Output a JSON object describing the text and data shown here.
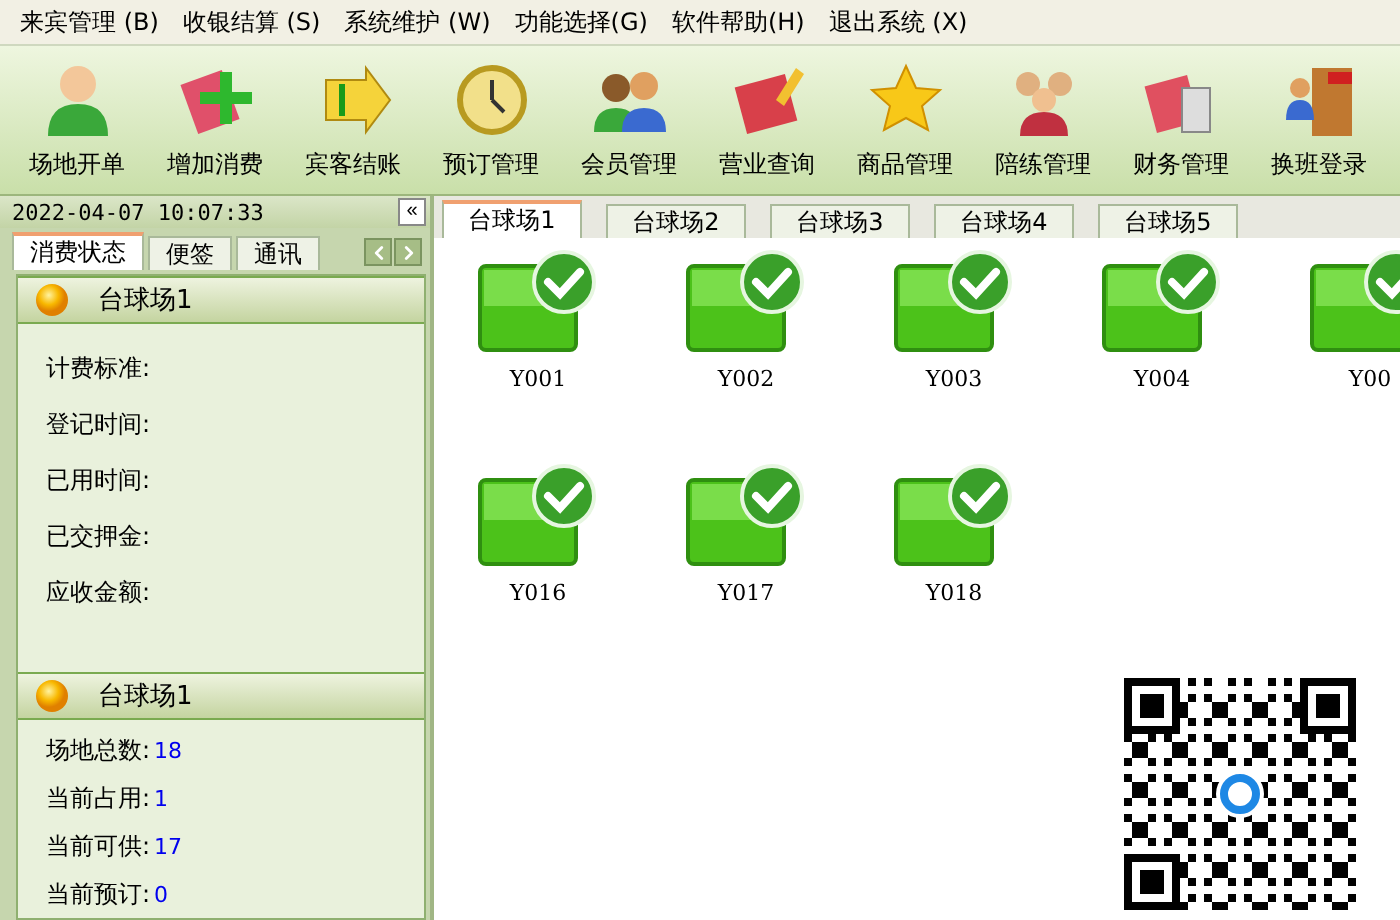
{
  "menu": [
    "来宾管理 (B)",
    "收银结算 (S)",
    "系统维护 (W)",
    "功能选择(G)",
    "软件帮助(H)",
    "退出系统 (X)"
  ],
  "toolbar": [
    "场地开单",
    "增加消费",
    "宾客结账",
    "预订管理",
    "会员管理",
    "营业查询",
    "商品管理",
    "陪练管理",
    "财务管理",
    "换班登录"
  ],
  "clock": "2022-04-07 10:07:33",
  "collapse": "«",
  "side_tabs": [
    {
      "label": "消费状态",
      "selected": true
    },
    {
      "label": "便签",
      "selected": false
    },
    {
      "label": "通讯",
      "selected": false
    }
  ],
  "sections": [
    {
      "title": "台球场1",
      "fields": [
        {
          "label": "计费标准:"
        },
        {
          "label": "登记时间:"
        },
        {
          "label": "已用时间:"
        },
        {
          "label": "已交押金:"
        },
        {
          "label": "应收金额:"
        }
      ]
    },
    {
      "title": "台球场1",
      "fields": [
        {
          "label": "场地总数:",
          "value": "18"
        },
        {
          "label": "当前占用:",
          "value": "1"
        },
        {
          "label": "当前可供:",
          "value": "17"
        },
        {
          "label": "当前预订:",
          "value": "0"
        }
      ]
    }
  ],
  "area_tabs": [
    {
      "label": "台球场1",
      "selected": true
    },
    {
      "label": "台球场2",
      "selected": false
    },
    {
      "label": "台球场3",
      "selected": false
    },
    {
      "label": "台球场4",
      "selected": false
    },
    {
      "label": "台球场5",
      "selected": false
    }
  ],
  "tables": [
    [
      "Y001",
      "Y002",
      "Y003",
      "Y004",
      "Y00"
    ],
    [
      "Y016",
      "Y017",
      "Y018"
    ]
  ]
}
